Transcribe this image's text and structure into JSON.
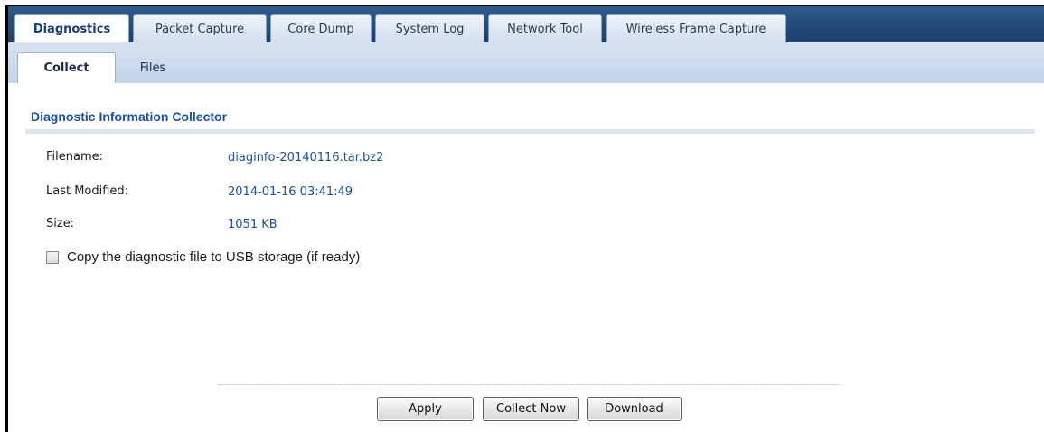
{
  "tabs": [
    {
      "label": "Diagnostics",
      "active": true
    },
    {
      "label": "Packet Capture",
      "active": false
    },
    {
      "label": "Core Dump",
      "active": false
    },
    {
      "label": "System Log",
      "active": false
    },
    {
      "label": "Network Tool",
      "active": false
    },
    {
      "label": "Wireless Frame Capture",
      "active": false
    }
  ],
  "subtabs": [
    {
      "label": "Collect",
      "active": true
    },
    {
      "label": "Files",
      "active": false
    }
  ],
  "section": {
    "title": "Diagnostic Information Collector"
  },
  "fields": {
    "filename_label": "Filename:",
    "filename_value": "diaginfo-20140116.tar.bz2",
    "modified_label": "Last Modified:",
    "modified_value": "2014-01-16 03:41:49",
    "size_label": "Size:",
    "size_value": "1051 KB"
  },
  "usb_option": {
    "label": "Copy the diagnostic file to USB storage (if ready)",
    "checked": false
  },
  "buttons": {
    "apply": "Apply",
    "collect_now": "Collect Now",
    "download": "Download"
  },
  "colors": {
    "tabbar": "#1b3f6e",
    "subbar": "#c3d4ea",
    "link_blue": "#1d4f9a"
  }
}
